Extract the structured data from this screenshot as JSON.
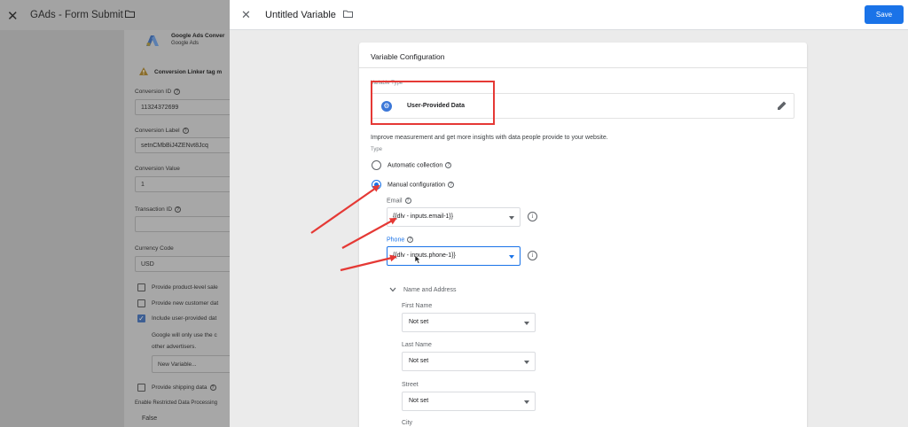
{
  "background_panel": {
    "title": "GAds - Form Submit",
    "tag_type_name": "Google Ads Conver",
    "tag_type_sub": "Google Ads",
    "warning_text": "Conversion Linker tag m",
    "conversion_id_label": "Conversion ID",
    "conversion_id_value": "11324372699",
    "conversion_label_label": "Conversion Label",
    "conversion_label_value": "setnCMbBiJ4ZENvt8Jcq",
    "conversion_value_label": "Conversion Value",
    "conversion_value_value": "1",
    "transaction_id_label": "Transaction ID",
    "currency_code_label": "Currency Code",
    "currency_code_value": "USD",
    "check_product_level": "Provide product-level sale",
    "check_new_customer": "Provide new customer dat",
    "check_user_provided": "Include user-provided dat",
    "note_line1": "Google will only use the c",
    "note_line2": "other advertisers.",
    "new_variable_button": "New Variable...",
    "check_shipping": "Provide shipping data",
    "restricted_label": "Enable Restricted Data Processing",
    "restricted_value": "False"
  },
  "drawer": {
    "title": "Untitled Variable",
    "save_label": "Save"
  },
  "config": {
    "title": "Variable Configuration",
    "variable_type_label": "Variable Type",
    "variable_type_name": "User-Provided Data",
    "description": "Improve measurement and get more insights with data people provide to your website.",
    "type_label": "Type",
    "radio_automatic": "Automatic collection",
    "radio_manual": "Manual configuration",
    "email_label": "Email",
    "email_value": "{{dlv - inputs.email-1}}",
    "phone_label": "Phone",
    "phone_value": "{{dlv - inputs.phone-1}}",
    "name_address_title": "Name and Address",
    "first_name_label": "First Name",
    "first_name_value": "Not set",
    "last_name_label": "Last Name",
    "last_name_value": "Not set",
    "street_label": "Street",
    "street_value": "Not set",
    "city_label": "City"
  },
  "colors": {
    "accent": "#1a73e8",
    "annotation_red": "#e53935"
  },
  "icons": [
    "close-icon",
    "folder-icon",
    "google-ads-logo-icon",
    "warning-icon",
    "gear-icon",
    "pencil-icon",
    "help-icon",
    "info-icon",
    "chevron-down-icon",
    "cursor-icon",
    "annotation-arrow"
  ]
}
